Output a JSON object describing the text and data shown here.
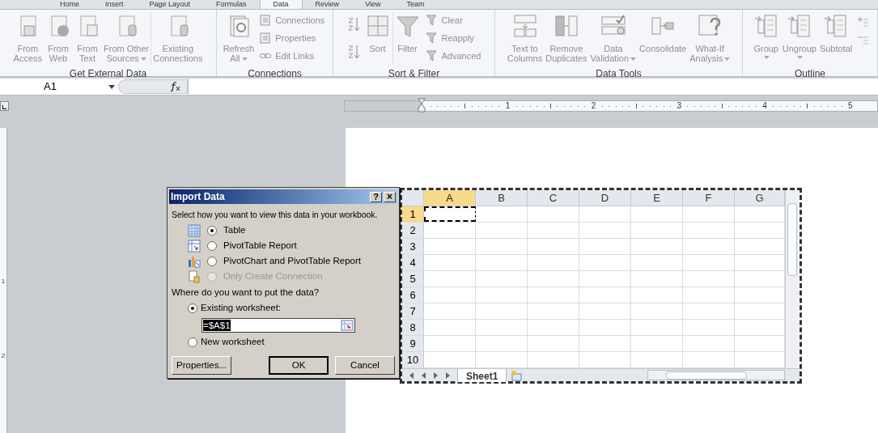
{
  "ribbon_tabs": [
    {
      "label": "Home",
      "selected": false
    },
    {
      "label": "Insert",
      "selected": false
    },
    {
      "label": "Page Layout",
      "selected": false
    },
    {
      "label": "Formulas",
      "selected": false
    },
    {
      "label": "Data",
      "selected": true
    },
    {
      "label": "Review",
      "selected": false
    },
    {
      "label": "View",
      "selected": false
    },
    {
      "label": "Team",
      "selected": false
    }
  ],
  "ribbon_groups": [
    {
      "label": "Get External Data",
      "items": [
        {
          "kind": "large",
          "lines": [
            "From",
            "Access"
          ],
          "dropdown": false
        },
        {
          "kind": "large",
          "lines": [
            "From",
            "Web"
          ],
          "dropdown": false
        },
        {
          "kind": "large",
          "lines": [
            "From",
            "Text"
          ],
          "dropdown": false
        },
        {
          "kind": "large",
          "lines": [
            "From Other",
            "Sources"
          ],
          "dropdown": true
        },
        {
          "kind": "large",
          "lines": [
            "Existing",
            "Connections"
          ],
          "dropdown": false
        }
      ]
    },
    {
      "label": "Connections",
      "items": [
        {
          "kind": "large",
          "lines": [
            "Refresh",
            "All"
          ],
          "dropdown": true
        },
        {
          "kind": "stack",
          "entries": [
            "Connections",
            "Properties",
            "Edit Links"
          ]
        }
      ]
    },
    {
      "label": "Sort & Filter",
      "items": [
        {
          "kind": "large",
          "lines": [
            "Sort"
          ],
          "dropdown": false
        },
        {
          "kind": "large",
          "lines": [
            "Filter"
          ],
          "dropdown": false
        },
        {
          "kind": "stack",
          "entries": [
            "Clear",
            "Reapply",
            "Advanced"
          ]
        }
      ]
    },
    {
      "label": "Data Tools",
      "items": [
        {
          "kind": "large",
          "lines": [
            "Text to",
            "Columns"
          ],
          "dropdown": false
        },
        {
          "kind": "large",
          "lines": [
            "Remove",
            "Duplicates"
          ],
          "dropdown": false
        },
        {
          "kind": "large",
          "lines": [
            "Data",
            "Validation"
          ],
          "dropdown": true
        },
        {
          "kind": "large",
          "lines": [
            "Consolidate"
          ],
          "dropdown": false
        },
        {
          "kind": "large",
          "lines": [
            "What-If",
            "Analysis"
          ],
          "dropdown": true
        }
      ]
    },
    {
      "label": "Outline",
      "items": [
        {
          "kind": "large",
          "lines": [
            "Group"
          ],
          "dropdown": true
        },
        {
          "kind": "large",
          "lines": [
            "Ungroup"
          ],
          "dropdown": true
        },
        {
          "kind": "large",
          "lines": [
            "Subtotal"
          ],
          "dropdown": false
        }
      ]
    }
  ],
  "name_box": "A1",
  "ruler": {
    "numbers": [
      "1",
      "2",
      "3",
      "4",
      "5"
    ],
    "vertical_numbers": [
      "1",
      "2"
    ]
  },
  "dialog": {
    "title": "Import Data",
    "help": "?",
    "close": "×",
    "view_prompt": "Select how you want to view this data in your workbook.",
    "view_options": [
      {
        "label": "Table",
        "selected": true,
        "disabled": false
      },
      {
        "label": "PivotTable Report",
        "selected": false,
        "disabled": false
      },
      {
        "label": "PivotChart and PivotTable Report",
        "selected": false,
        "disabled": false
      },
      {
        "label": "Only Create Connection",
        "selected": false,
        "disabled": true
      }
    ],
    "location_prompt": "Where do you want to put the data?",
    "location_options": [
      {
        "label": "Existing worksheet:",
        "selected": true
      },
      {
        "label": "New worksheet",
        "selected": false
      }
    ],
    "range_value": "=$A$1",
    "buttons": [
      "Properties...",
      "OK",
      "Cancel"
    ]
  },
  "sheet": {
    "columns": [
      {
        "label": "A",
        "selected": true
      },
      {
        "label": "B",
        "selected": false
      },
      {
        "label": "C",
        "selected": false
      },
      {
        "label": "D",
        "selected": false
      },
      {
        "label": "E",
        "selected": false
      },
      {
        "label": "F",
        "selected": false
      },
      {
        "label": "G",
        "selected": false
      }
    ],
    "rows": [
      {
        "label": "1",
        "selected": true
      },
      {
        "label": "2",
        "selected": false
      },
      {
        "label": "3",
        "selected": false
      },
      {
        "label": "4",
        "selected": false
      },
      {
        "label": "5",
        "selected": false
      },
      {
        "label": "6",
        "selected": false
      },
      {
        "label": "7",
        "selected": false
      },
      {
        "label": "8",
        "selected": false
      },
      {
        "label": "9",
        "selected": false
      },
      {
        "label": "10",
        "selected": false
      }
    ],
    "sheet_tab": "Sheet1"
  }
}
